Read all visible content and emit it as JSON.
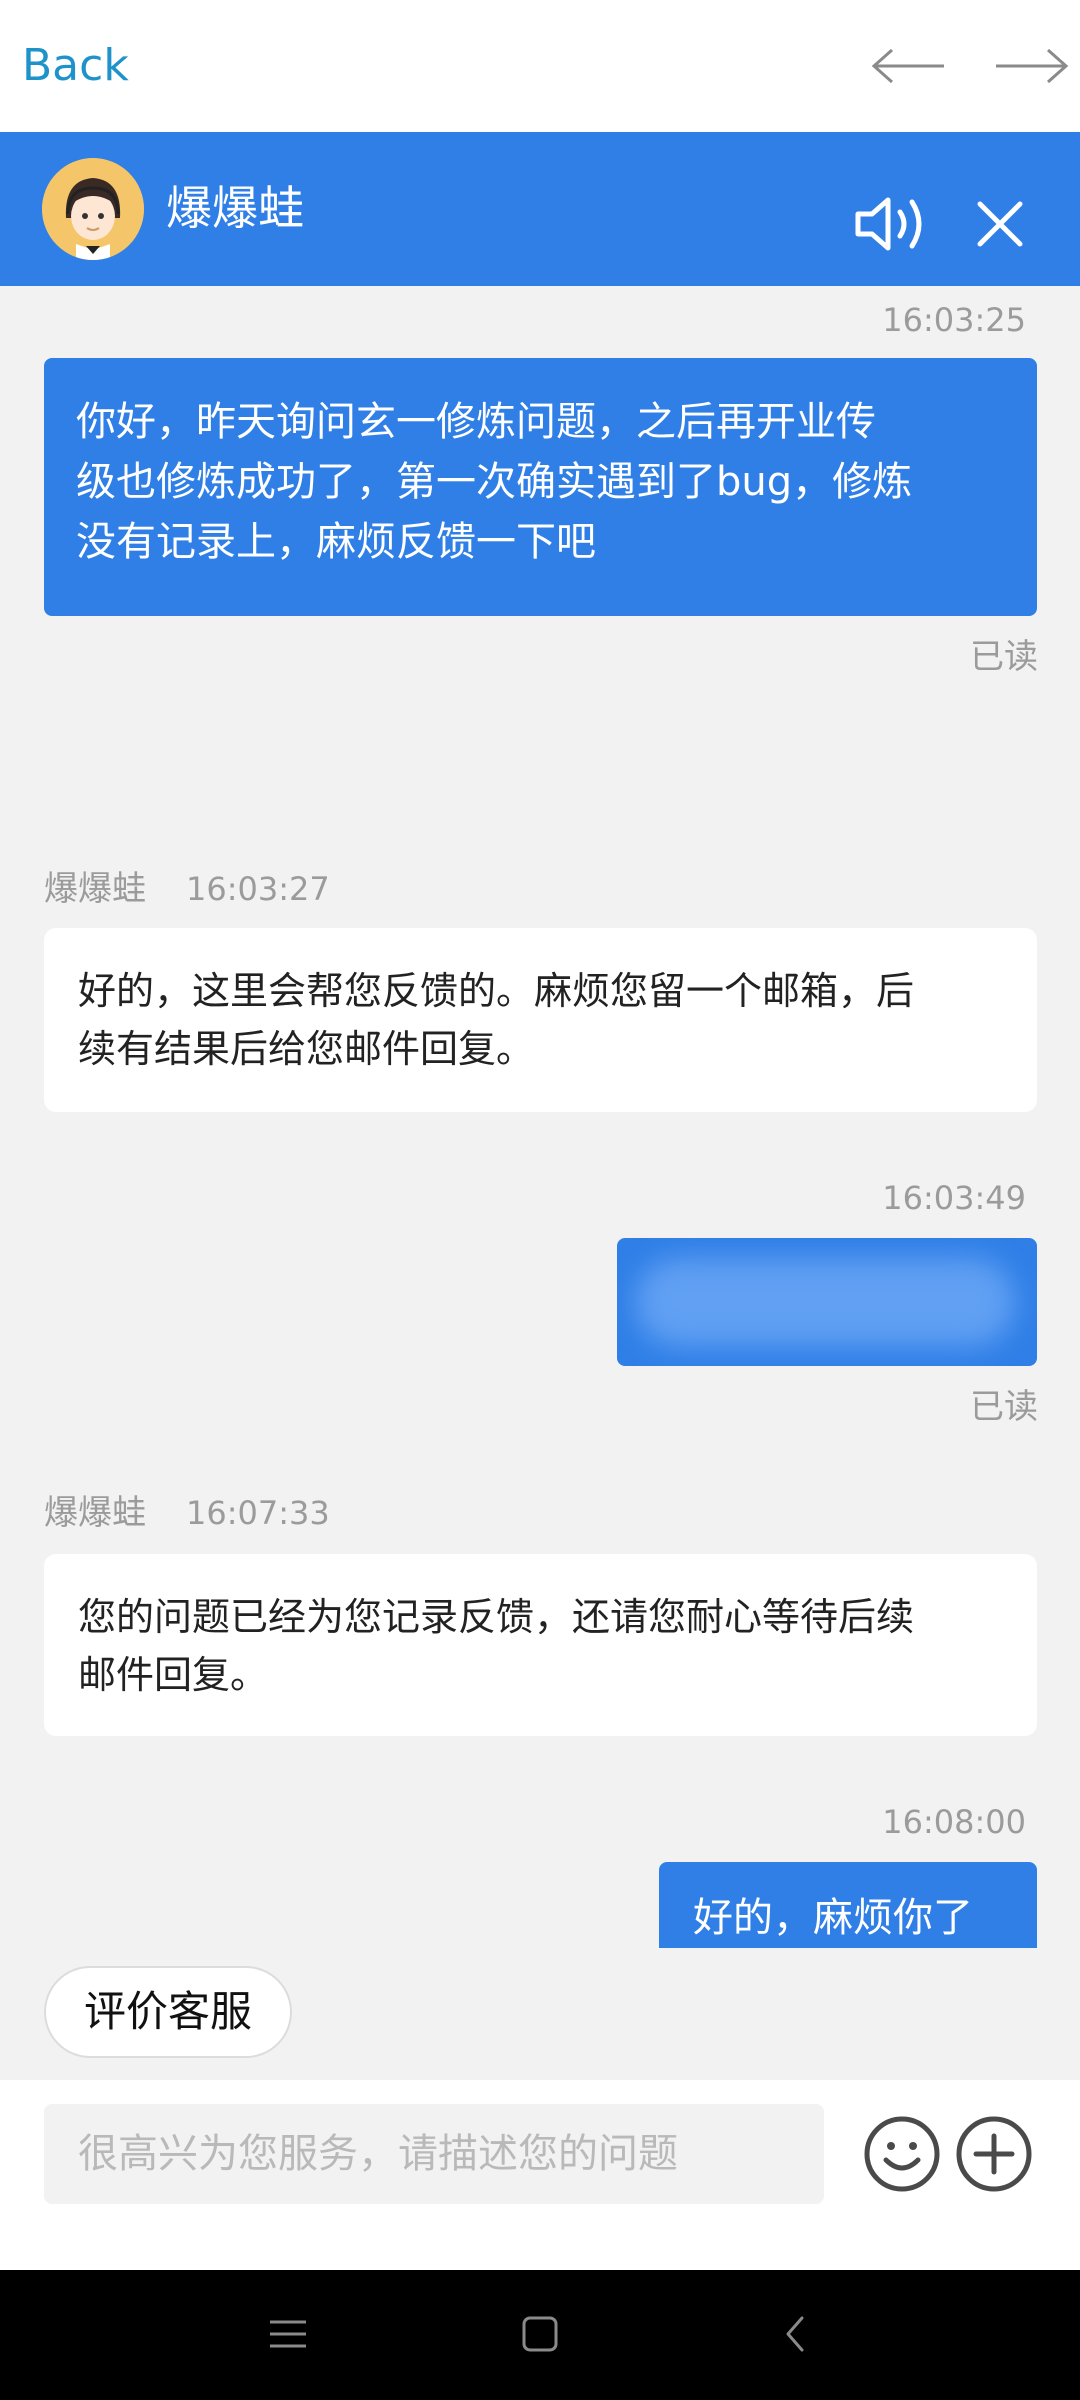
{
  "topnav": {
    "back_label": "Back",
    "back_arrow_icon": "arrow-left-icon",
    "forward_arrow_icon": "arrow-right-icon"
  },
  "header": {
    "agent_name": "爆爆蛙",
    "avatar_icon": "agent-avatar-icon",
    "speaker_icon": "speaker-icon",
    "close_icon": "close-icon"
  },
  "messages": [
    {
      "side": "user",
      "timestamp": "16:03:25",
      "text_lines": [
        "你好，昨天询问玄一修炼问题，之后再开业传",
        "级也修炼成功了，第一次确实遇到了bug，修炼",
        "没有记录上，麻烦反馈一下吧"
      ],
      "status": "已读"
    },
    {
      "side": "agent",
      "sender": "爆爆蛙",
      "timestamp": "16:03:27",
      "text_lines": [
        "好的，这里会帮您反馈的。麻烦您留一个邮箱，后",
        "续有结果后给您邮件回复。"
      ]
    },
    {
      "side": "user",
      "timestamp": "16:03:49",
      "text_lines": [],
      "blurred": true,
      "status": "已读"
    },
    {
      "side": "agent",
      "sender": "爆爆蛙",
      "timestamp": "16:07:33",
      "text_lines": [
        "您的问题已经为您记录反馈，还请您耐心等待后续",
        "邮件回复。"
      ]
    },
    {
      "side": "user",
      "timestamp": "16:08:00",
      "text_lines": [
        "好的，麻烦你了"
      ]
    }
  ],
  "rate_button_label": "评价客服",
  "input": {
    "placeholder": "很高兴为您服务，请描述您的问题",
    "emoji_icon": "emoji-icon",
    "plus_icon": "plus-circle-icon"
  },
  "system_nav": {
    "menu_icon": "menu-icon",
    "home_icon": "home-icon",
    "back_icon": "back-chevron-icon"
  },
  "colors": {
    "brand_blue": "#2f7fe7",
    "back_link": "#1e93c9",
    "background": "#f2f2f2"
  }
}
